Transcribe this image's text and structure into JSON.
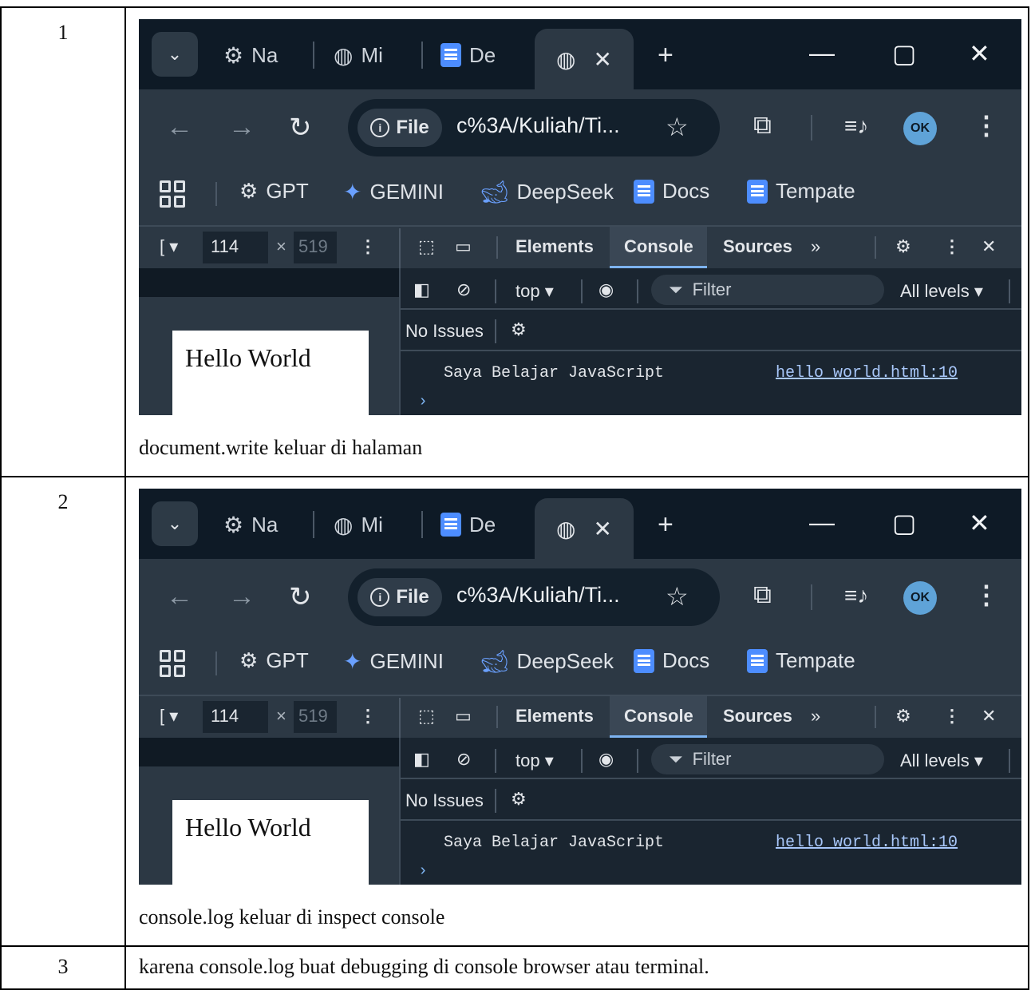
{
  "rows": [
    {
      "number": "1",
      "caption": "document.write keluar di halaman",
      "screenshot": {
        "tabs": [
          "Na",
          "Mi",
          "De"
        ],
        "url_chip": "File",
        "url": "c%3A/Kuliah/Ti...",
        "avatar": "OK",
        "bookmarks": [
          "GPT",
          "GEMINI",
          "DeepSeek",
          "Docs",
          "Tempate"
        ],
        "device_dims": {
          "dropdown": "[ ▾",
          "width": "114",
          "times": "×",
          "height": "519"
        },
        "devtools_tabs": [
          "Elements",
          "Console",
          "Sources"
        ],
        "context": "top ▾",
        "filter_placeholder": "Filter",
        "levels": "All levels ▾",
        "issues": "No Issues",
        "page_text": "Hello World",
        "log_message": "Saya Belajar JavaScript",
        "log_source": "hello_world.html:10",
        "prompt": "›"
      }
    },
    {
      "number": "2",
      "caption": "console.log keluar di inspect console",
      "screenshot": {
        "tabs": [
          "Na",
          "Mi",
          "De"
        ],
        "url_chip": "File",
        "url": "c%3A/Kuliah/Ti...",
        "avatar": "OK",
        "bookmarks": [
          "GPT",
          "GEMINI",
          "DeepSeek",
          "Docs",
          "Tempate"
        ],
        "device_dims": {
          "dropdown": "[ ▾",
          "width": "114",
          "times": "×",
          "height": "519"
        },
        "devtools_tabs": [
          "Elements",
          "Console",
          "Sources"
        ],
        "context": "top ▾",
        "filter_placeholder": "Filter",
        "levels": "All levels ▾",
        "issues": "No Issues",
        "page_text": "Hello World",
        "log_message": "Saya Belajar JavaScript",
        "log_source": "hello_world.html:10",
        "prompt": "›"
      }
    },
    {
      "number": "3",
      "text": "karena console.log buat debugging di console browser atau terminal."
    }
  ],
  "colors": {
    "frame_bg": "#1f2b36",
    "tabbar_bg": "#0e1a26",
    "toolbar_bg": "#2c3844",
    "console_bg": "#1a2530",
    "link": "#a8c7fa",
    "accent": "#7db3f0"
  },
  "icons": [
    "chevron-down-icon",
    "openai-icon",
    "globe-icon",
    "docs-icon",
    "close-icon",
    "plus-icon",
    "minimize-icon",
    "maximize-icon",
    "back-icon",
    "forward-icon",
    "reload-icon",
    "info-icon",
    "star-icon",
    "extensions-icon",
    "media-icon",
    "kebab-icon",
    "apps-grid-icon",
    "gemini-icon",
    "deepseek-icon",
    "inspect-icon",
    "device-toolbar-icon",
    "more-tabs-icon",
    "settings-icon",
    "sidebar-icon",
    "clear-icon",
    "eye-icon",
    "filter-icon"
  ]
}
